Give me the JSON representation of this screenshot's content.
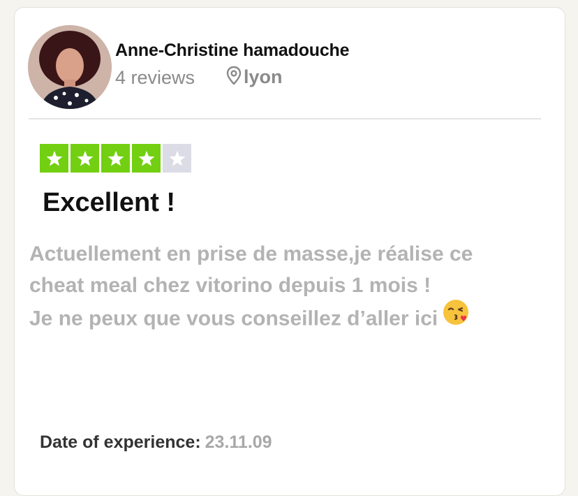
{
  "reviewer": {
    "name": "Anne-Christine hamadouche",
    "review_count": "4 reviews",
    "location": "lyon",
    "avatar_icon": "avatar-photo",
    "location_icon": "map-pin-icon"
  },
  "rating": {
    "stars": 4,
    "max_stars": 5,
    "filled_color": "#73cf11",
    "empty_color": "#dcdce6"
  },
  "review": {
    "title": "Excellent !",
    "body_lines": [
      "Actuellement en prise de masse,je réalise ce",
      "cheat meal chez vitorino depuis 1 mois !",
      "Je ne peux que vous conseillez d’aller ici"
    ],
    "emoji_icon": "kissing-face-emoji-icon"
  },
  "experience": {
    "label": "Date of experience:",
    "date": "23.11.09"
  }
}
